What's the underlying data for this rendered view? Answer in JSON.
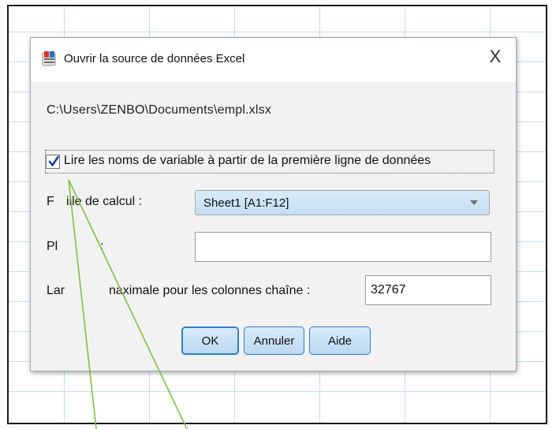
{
  "dialog": {
    "title": "Ouvrir la source de données Excel",
    "close_glyph": "X",
    "file_path": "C:\\Users\\ZENBO\\Documents\\empl.xlsx",
    "read_names_checkbox": {
      "label": "Lire les noms de variable à partir de la première ligne de données",
      "checked": true
    },
    "worksheet": {
      "label_visible_start": "F",
      "label_visible_end": "ille de calcul :",
      "selected": "Sheet1 [A1:F12]"
    },
    "range": {
      "label_visible_start": "Pl",
      "label_visible_end": ":",
      "value": ""
    },
    "max_width": {
      "label_visible_start": "Lar",
      "label_visible_end": "naximale pour les colonnes chaîne :",
      "value": "32767"
    },
    "buttons": {
      "ok": "OK",
      "cancel": "Annuler",
      "help": "Aide"
    }
  },
  "colors": {
    "accent_border": "#2f7fcb",
    "button_fill": "#c9e1f6",
    "annotation_arrow": "#7cc242",
    "grid_line": "#c6dcee"
  },
  "icons": {
    "app": "spss-data-icon",
    "checkmark": "checkmark-icon",
    "dropdown": "chevron-down-icon"
  }
}
